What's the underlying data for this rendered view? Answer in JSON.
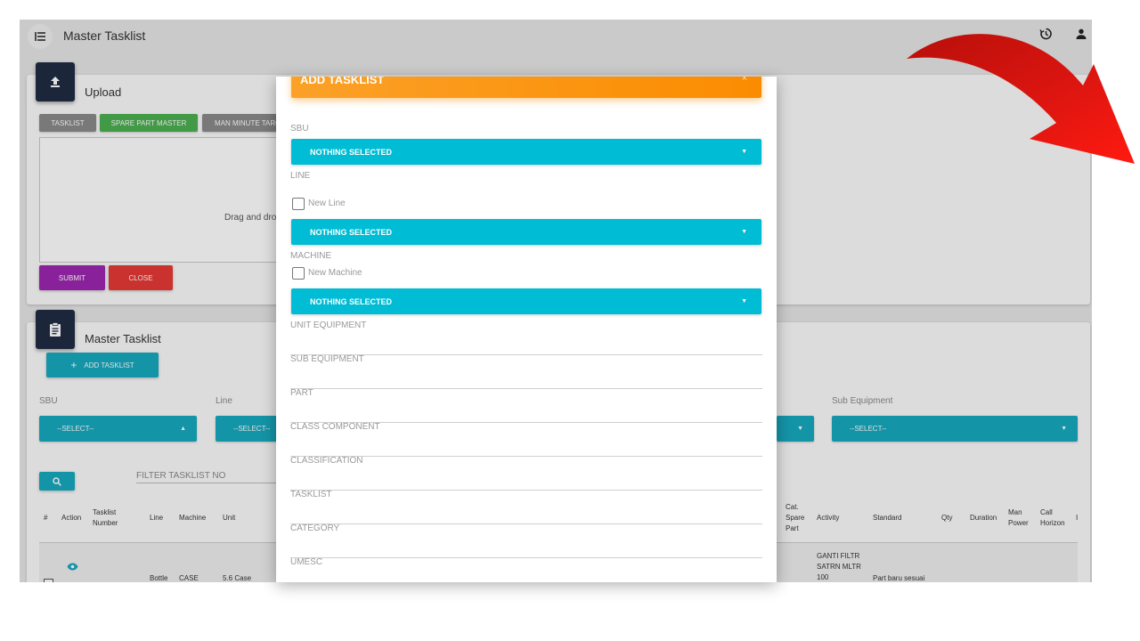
{
  "header": {
    "title": "Master Tasklist",
    "menu_icon": "menu-icon",
    "history_icon": "history-icon",
    "user_icon": "user-icon"
  },
  "upload": {
    "title": "Upload",
    "tabs": [
      "TASKLIST",
      "SPARE PART MASTER",
      "MAN MINUTE TARG"
    ],
    "drop_text": "Drag and dro",
    "submit_label": "SUBMIT",
    "close_label": "CLOSE"
  },
  "master": {
    "title": "Master Tasklist",
    "add_label": "ADD TASKLIST",
    "filters": {
      "sbu_label": "SBU",
      "line_label": "Line",
      "sub_equipment_label": "Sub Equipment",
      "select_text": "--SELECT--",
      "line_select_text": "--SELECT--"
    },
    "filter_tasklist_placeholder": "FILTER TASKLIST NO",
    "table": {
      "headers": [
        "#",
        "Action",
        "Tasklist Number",
        "Line",
        "Machine",
        "Unit",
        "Cat. Spare Part",
        "Activity",
        "Standard",
        "Qty",
        "Duration",
        "Man Power",
        "Call Horizon",
        "I"
      ],
      "row": {
        "line": "Bottle",
        "machine": "CASE",
        "unit": "5.6 Case",
        "activity": "GANTI FILTR SATRN MLTR 100",
        "standard": "Part baru sesuai"
      }
    }
  },
  "modal": {
    "title": "ADD TASKLIST",
    "close": "×",
    "sbu_label": "SBU",
    "line_label": "LINE",
    "new_line_label": "New Line",
    "machine_label": "MACHINE",
    "new_machine_label": "New Machine",
    "nothing_selected": "NOTHING SELECTED",
    "fields": [
      "UNIT EQUIPMENT",
      "SUB EQUIPMENT",
      "PART",
      "CLASS COMPONENT",
      "CLASSIFICATION",
      "TASKLIST",
      "CATEGORY",
      "UMESC"
    ]
  },
  "colors": {
    "modal_header": "#fb8c00",
    "select": "#00bcd4",
    "submit": "#9c27b0",
    "close": "#e53935",
    "spare_part_tab": "#43a047",
    "arrow": "#e8140e"
  }
}
